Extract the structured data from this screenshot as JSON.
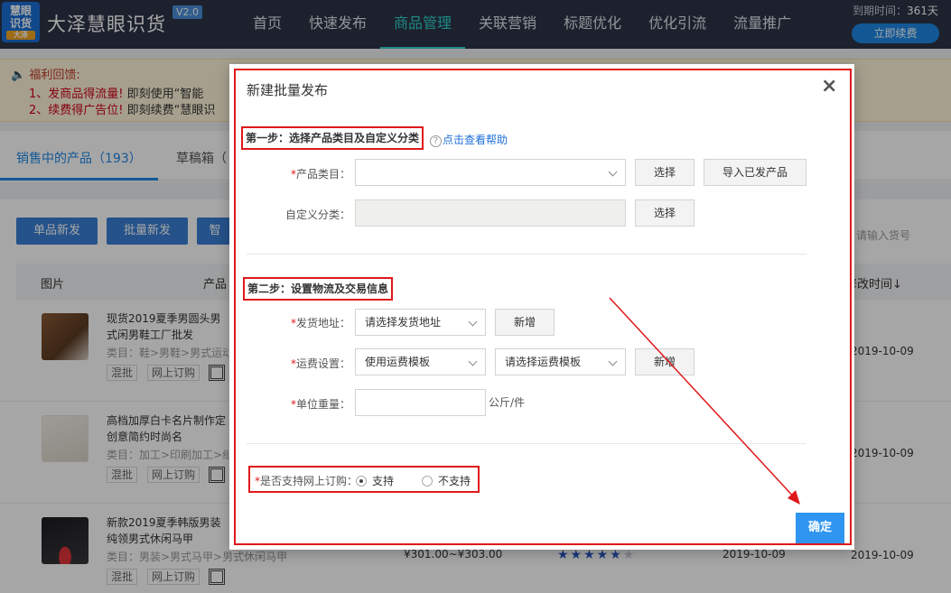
{
  "app": {
    "logo_text": "慧眼识货",
    "logo_tag": "大泽",
    "brand": "大泽慧眼识货",
    "version": "V2.0",
    "expiry_label": "到期时间：",
    "expiry_value": "361天",
    "renew_label": "立即续费"
  },
  "nav": [
    {
      "label": "首页"
    },
    {
      "label": "快速发布"
    },
    {
      "label": "商品管理"
    },
    {
      "label": "关联营销"
    },
    {
      "label": "标题优化"
    },
    {
      "label": "优化引流"
    },
    {
      "label": "流量推广"
    }
  ],
  "notice": {
    "title": "福利回馈:",
    "line1_a": "1、发商品得流量!",
    "line1_b": "即刻使用“智能",
    "line2_a": "2、续费得广告位!",
    "line2_b": "即刻续费“慧眼识"
  },
  "tabs": {
    "selling": "销售中的产品（193）",
    "drafts": "草稿箱（"
  },
  "toolbar": {
    "single": "单品新发",
    "batch": "批量新发",
    "smart": "智",
    "search_placeholder": "请输入货号"
  },
  "table": {
    "col_image": "图片",
    "col_product": "产品",
    "col_modified": "修改时间↓",
    "rows": [
      {
        "name": "现货2019夏季男圆头男式闲男鞋工厂批发",
        "category": "类目：鞋>男鞋>男式运动",
        "tag1": "混批",
        "tag2": "网上订购",
        "date": "2019-10-09"
      },
      {
        "name": "高档加厚白卡名片制作定创意简约时尚名",
        "category": "类目：加工>印刷加工>纸",
        "tag1": "混批",
        "tag2": "网上订购",
        "date": "2019-10-09"
      },
      {
        "name": "新款2019夏季韩版男装纯领男式休闲马甲",
        "category": "类目：男装>男式马甲>男式休闲马甲",
        "tag1": "混批",
        "tag2": "网上订购",
        "date": "2019-10-09",
        "price": "¥301.00~¥303.00",
        "date2": "2019-10-09"
      }
    ]
  },
  "modal": {
    "title": "新建批量发布",
    "close": "×",
    "step1": "第一步：选择产品类目及自定义分类",
    "help": "点击查看帮助",
    "category_label": "产品类目：",
    "category_value": "",
    "select_btn": "选择",
    "import_btn": "导入已发产品",
    "custom_label": "自定义分类：",
    "custom_select_btn": "选择",
    "step2": "第二步：设置物流及交易信息",
    "address_label": "发货地址：",
    "address_value": "请选择发货地址",
    "add_btn": "新增",
    "freight_label": "运费设置：",
    "freight_mode": "使用运费模板",
    "freight_template": "请选择运费模板",
    "freight_add_btn": "新增",
    "weight_label": "单位重量：",
    "weight_value": "",
    "weight_unit": "公斤/件",
    "online_label": "是否支持网上订购：",
    "online_yes": "支持",
    "online_no": "不支持",
    "confirm": "确定",
    "required_mark": "*"
  },
  "rating": {
    "value": 5,
    "max": 6
  }
}
